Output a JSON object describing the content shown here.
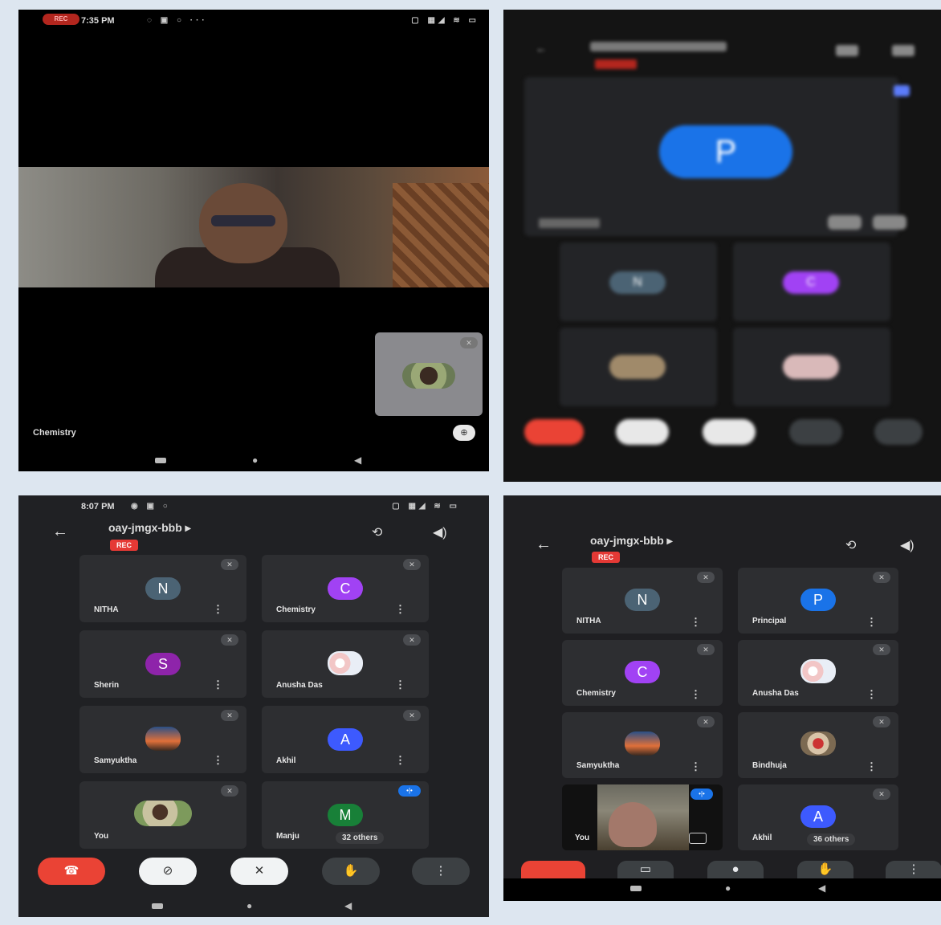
{
  "s1": {
    "status": {
      "rec": "REC",
      "time": "7:35 PM"
    },
    "caption": "Chemistry"
  },
  "s2": {
    "main_avatar": "P",
    "tiles": [
      {
        "avatar": "N"
      },
      {
        "avatar": "C"
      }
    ]
  },
  "s3": {
    "status": {
      "time": "8:07 PM"
    },
    "meeting_code": "oay-jmgx-bbb",
    "rec_label": "REC",
    "tiles": [
      {
        "name": "NITHA",
        "avatar": "N",
        "color": "#4b6374"
      },
      {
        "name": "Chemistry",
        "avatar": "C",
        "color": "#a142f4"
      },
      {
        "name": "Sherin",
        "avatar": "S",
        "color": "#8e24aa"
      },
      {
        "name": "Anusha Das",
        "avatar": "",
        "color": "#f2d7d7"
      },
      {
        "name": "Samyuktha",
        "avatar": "",
        "color": "#1f3b63"
      },
      {
        "name": "Akhil",
        "avatar": "A",
        "color": "#3d5afe"
      },
      {
        "name": "You",
        "avatar": "",
        "color": "#8aa26b"
      },
      {
        "name": "Manju",
        "avatar": "M",
        "color": "#188038",
        "others": "32 others"
      }
    ]
  },
  "s4": {
    "meeting_code": "oay-jmgx-bbb",
    "rec_label": "REC",
    "tiles": [
      {
        "name": "NITHA",
        "avatar": "N",
        "color": "#4b6374"
      },
      {
        "name": "Principal",
        "avatar": "P",
        "color": "#1a73e8"
      },
      {
        "name": "Chemistry",
        "avatar": "C",
        "color": "#a142f4"
      },
      {
        "name": "Anusha Das",
        "avatar": "",
        "color": "#f2d7d7"
      },
      {
        "name": "Samyuktha",
        "avatar": "",
        "color": "#1f3b63"
      },
      {
        "name": "Bindhuja",
        "avatar": "",
        "color": "#b8453f"
      },
      {
        "name": "You",
        "avatar": "",
        "color": "#7a6a5a"
      },
      {
        "name": "Akhil",
        "avatar": "A",
        "color": "#3d5afe",
        "others": "36 others"
      }
    ]
  },
  "icons": {
    "end_call": "phone-hangup-icon",
    "camera": "camera-off-icon",
    "mic": "mic-off-icon",
    "hand": "raise-hand-icon",
    "more": "more-vert-icon"
  }
}
